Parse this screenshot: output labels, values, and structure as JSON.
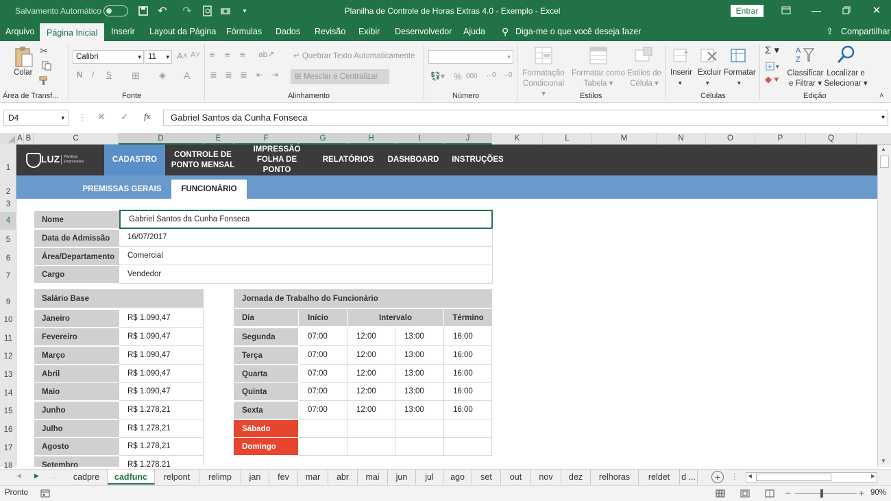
{
  "titlebar": {
    "autosave_label": "Salvamento Automático",
    "autosave_state": "Desativado",
    "doc_title": "Planilha de Controle de Horas Extras 4.0 - Exemplo  -  Excel",
    "signin_label": "Entrar"
  },
  "menu": {
    "items": [
      "Arquivo",
      "Página Inicial",
      "Inserir",
      "Layout da Página",
      "Fórmulas",
      "Dados",
      "Revisão",
      "Exibir",
      "Desenvolvedor",
      "Ajuda"
    ],
    "tell_me": "Diga-me o que você deseja fazer",
    "share": "Compartilhar"
  },
  "ribbon": {
    "paste": "Colar",
    "clipboard_group": "Área de Transf...",
    "font_name": "Calibri",
    "font_size": "11",
    "bold": "N",
    "italic": "I",
    "underline": "S",
    "font_group": "Fonte",
    "wrap_text": "Quebrar Texto Automaticamente",
    "merge_center": "Mesclar e Centralizar",
    "align_group": "Alinhamento",
    "number_format": "",
    "percent": "%",
    "thousands": "000",
    "number_group": "Número",
    "cond_format": [
      "Formatação",
      "Condicional"
    ],
    "format_table": [
      "Formatar como",
      "Tabela"
    ],
    "cell_styles": [
      "Estilos de",
      "Célula"
    ],
    "styles_group": "Estilos",
    "insert": "Inserir",
    "delete": "Excluir",
    "format": "Formatar",
    "cells_group": "Células",
    "sort_filter": [
      "Classificar",
      "e Filtrar"
    ],
    "find_select": [
      "Localizar e",
      "Selecionar"
    ],
    "edit_group": "Edição"
  },
  "formula": {
    "name_box": "D4",
    "content": "Gabriel Santos da Cunha Fonseca"
  },
  "columns": [
    "A",
    "B",
    "C",
    "D",
    "E",
    "F",
    "G",
    "H",
    "I",
    "J",
    "K",
    "L",
    "M",
    "N",
    "O",
    "P",
    "Q"
  ],
  "rows": [
    "1",
    "2",
    "3",
    "4",
    "5",
    "6",
    "7",
    "9",
    "10",
    "11",
    "12",
    "13",
    "14",
    "15",
    "16",
    "17",
    "18"
  ],
  "app": {
    "logo": "LUZ",
    "logo_sub": "Planilhas Empresariais",
    "nav": [
      "CADASTRO",
      "CONTROLE DE\nPONTO MENSAL",
      "IMPRESSÃO\nFOLHA DE PONTO",
      "RELATÓRIOS",
      "DASHBOARD",
      "INSTRUÇÕES"
    ],
    "subnav": [
      "PREMISSAS GERAIS",
      "FUNCIONÁRIO"
    ]
  },
  "employee": [
    {
      "label": "Nome",
      "value": "Gabriel Santos da Cunha Fonseca"
    },
    {
      "label": "Data de Admissão",
      "value": "16/07/2017"
    },
    {
      "label": "Área/Departamento",
      "value": "Comercial"
    },
    {
      "label": "Cargo",
      "value": "Vendedor"
    }
  ],
  "salary": {
    "title": "Salário Base",
    "rows": [
      {
        "month": "Janeiro",
        "value": "R$ 1.090,47"
      },
      {
        "month": "Fevereiro",
        "value": "R$ 1.090,47"
      },
      {
        "month": "Março",
        "value": "R$ 1.090,47"
      },
      {
        "month": "Abril",
        "value": "R$ 1.090,47"
      },
      {
        "month": "Maio",
        "value": "R$ 1.090,47"
      },
      {
        "month": "Junho",
        "value": "R$ 1.278,21"
      },
      {
        "month": "Julho",
        "value": "R$ 1.278,21"
      },
      {
        "month": "Agosto",
        "value": "R$ 1.278,21"
      },
      {
        "month": "Setembro",
        "value": "R$ 1.278,21"
      }
    ]
  },
  "schedule": {
    "title": "Jornada de Trabalho do Funcionário",
    "headers": {
      "day": "Dia",
      "start": "Início",
      "break": "Intervalo",
      "end": "Término"
    },
    "rows": [
      {
        "day": "Segunda",
        "start": "07:00",
        "b1": "12:00",
        "b2": "13:00",
        "end": "16:00"
      },
      {
        "day": "Terça",
        "start": "07:00",
        "b1": "12:00",
        "b2": "13:00",
        "end": "16:00"
      },
      {
        "day": "Quarta",
        "start": "07:00",
        "b1": "12:00",
        "b2": "13:00",
        "end": "16:00"
      },
      {
        "day": "Quinta",
        "start": "07:00",
        "b1": "12:00",
        "b2": "13:00",
        "end": "16:00"
      },
      {
        "day": "Sexta",
        "start": "07:00",
        "b1": "12:00",
        "b2": "13:00",
        "end": "16:00"
      },
      {
        "day": "Sábado",
        "start": "",
        "b1": "",
        "b2": "",
        "end": ""
      },
      {
        "day": "Domingo",
        "start": "",
        "b1": "",
        "b2": "",
        "end": ""
      }
    ],
    "weekend_color": "#e8452f"
  },
  "sheets": [
    "cadpre",
    "cadfunc",
    "relpont",
    "relimp",
    "jan",
    "fev",
    "mar",
    "abr",
    "mai",
    "jun",
    "jul",
    "ago",
    "set",
    "out",
    "nov",
    "dez",
    "relhoras",
    "reldet",
    "d ..."
  ],
  "status": {
    "ready": "Pronto",
    "zoom": "90%"
  },
  "colors": {
    "excel_green": "#217346",
    "nav_dark": "#3b3b3b",
    "nav_active": "#5b8fc9",
    "subnav": "#6a99cc"
  }
}
